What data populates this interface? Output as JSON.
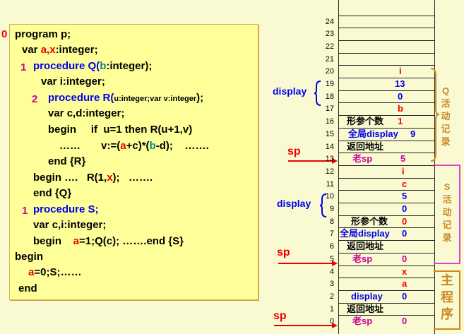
{
  "code": {
    "line0_num": "0",
    "line0": "program p;",
    "line1a": "var ",
    "line1b": "a,x",
    ":integer;": ":integer;",
    "line2_num": "1",
    "line2a": "procedure Q(",
    "line2b": "b",
    "line2c": ":integer);",
    "line3": "var i:integer;",
    "line4_num": "2",
    "line4a": "procedure R(",
    "line4b": "u:integer;var v:integer",
    "line4c": ");",
    "line5": "var c,d:integer;",
    "line6": "begin     if  u=1 then R(u+1,v)",
    "line7a": "……       v:=(",
    "line7b": "a",
    "line7c": "+c)*(",
    "line7d": "b",
    "line7e": "-d);    …….",
    "line8": "end {R}",
    "line9a": "begin ….   R(1,",
    "line9b": "x",
    "line9c": ");   …….",
    "line10": "end {Q}",
    "line11_num": "1",
    "line11": "procedure S;",
    "line12": "var c,i:integer;",
    "line13a": "begin    ",
    "line13b": "a",
    "line13c": "=1;Q(c); …….end {S}",
    "line14": "begin",
    "line15a": "a",
    "line15b": "=0;S;……",
    "line16": "end"
  },
  "stack": {
    "indices": [
      "0",
      "1",
      "2",
      "3",
      "4",
      "5",
      "6",
      "7",
      "8",
      "9",
      "10",
      "11",
      "12",
      "13",
      "14",
      "15",
      "16",
      "17",
      "18",
      "19",
      "20",
      "21",
      "22",
      "23",
      "24"
    ],
    "cells": {
      "c0a": "老sp",
      "c0b": "0",
      "c1": "返回地址",
      "c2a": "display",
      "c2b": "0",
      "c3": "a",
      "c4": "x",
      "c5a": "老sp",
      "c5b": "0",
      "c6": "返回地址",
      "c7a": "全局display",
      "c7b": "0",
      "c8a": "形参个数",
      "c8b": "0",
      "c9": "0",
      "c10": "5",
      "c11": "c",
      "c12": "i",
      "c13a": "老sp",
      "c13b": "5",
      "c14": "返回地址",
      "c15a": "全局display",
      "c15b": "9",
      "c16a": "形参个数",
      "c16b": "1",
      "c17": "b",
      "c18": "0",
      "c19": "13",
      "c20": "i"
    }
  },
  "labels": {
    "display_upper": "display",
    "display_lower": "display",
    "sp1": "sp",
    "sp2": "sp",
    "sp3": "sp",
    "q_record": [
      "Q",
      "活",
      "动",
      "记",
      "录"
    ],
    "s_record": [
      "S",
      "活",
      "动",
      "记",
      "录"
    ],
    "main_prog": [
      "主",
      "程",
      "序"
    ]
  }
}
